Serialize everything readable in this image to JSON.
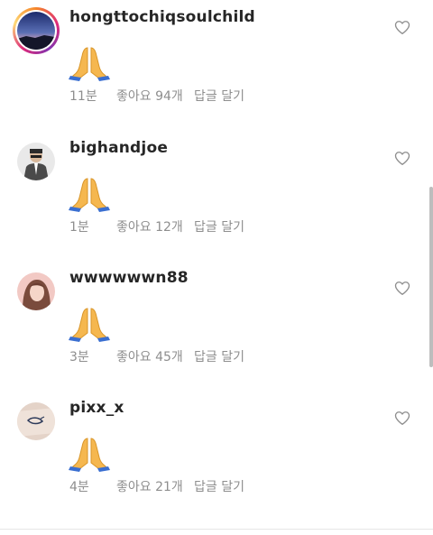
{
  "comments": [
    {
      "username": "hongttochiqsoulchild",
      "text": "🙏",
      "time": "11분",
      "likes": "좋아요 94개",
      "reply": "답글 달기",
      "avatar_icon": "night-sky-avatar",
      "has_story_ring": true
    },
    {
      "username": "bighandjoe",
      "text": "🙏",
      "time": "1분",
      "likes": "좋아요 12개",
      "reply": "답글 달기",
      "avatar_icon": "man-portrait-avatar",
      "has_story_ring": false
    },
    {
      "username": "wwwwwwn88",
      "text": "🙏",
      "time": "3분",
      "likes": "좋아요 45개",
      "reply": "답글 달기",
      "avatar_icon": "woman-portrait-avatar",
      "has_story_ring": false
    },
    {
      "username": "pixx_x",
      "text": "🙏",
      "time": "4분",
      "likes": "좋아요 21개",
      "reply": "답글 달기",
      "avatar_icon": "tattoo-avatar",
      "has_story_ring": false
    }
  ],
  "colors": {
    "text": "#262626",
    "meta": "#8e8e8e",
    "heart_outline": "#8e8e8e"
  }
}
